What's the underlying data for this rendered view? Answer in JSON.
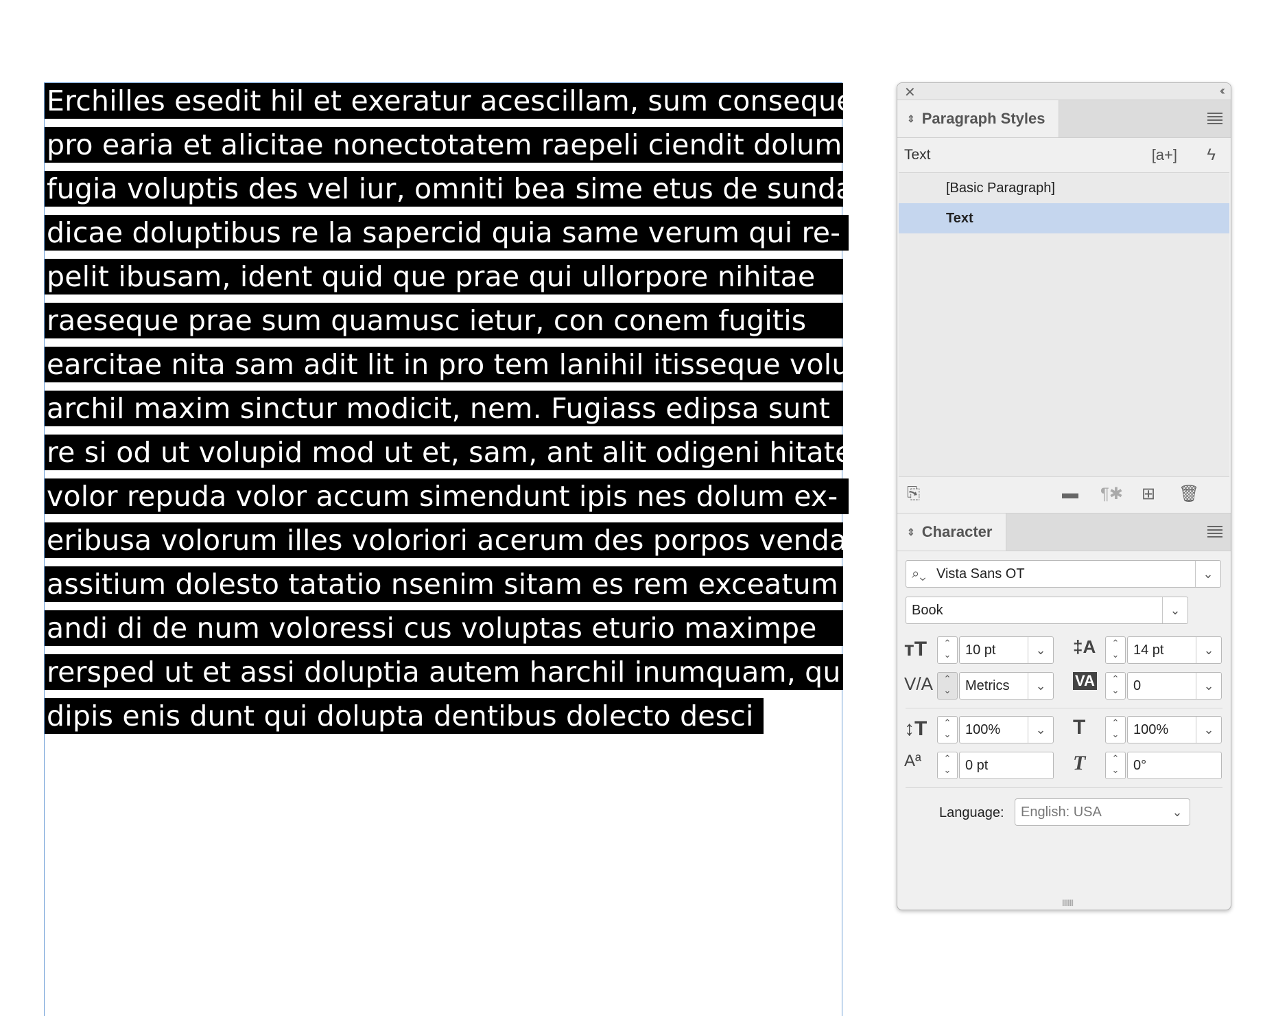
{
  "body_text": {
    "lines": [
      "Erchilles esedit hil et exeratur acescillam, sum conseque",
      "pro earia et alicitae nonectotatem raepeli ciendit dolum",
      "fugia voluptis des vel iur, omniti bea sime etus de sunda",
      "dicae doluptibus re la sapercid quia same verum qui re-",
      "pelit ibusam, ident quid que prae qui ullorpore nihitae",
      "raeseque prae sum quamusc ietur, con conem fugitis",
      "earcitae nita sam adit lit in pro tem lanihil itisseque volut",
      "archil maxim sinctur modicit, nem. Fugiass edipsa sunt",
      "re si od ut volupid mod ut et, sam, ant alit odigeni hitate",
      "volor repuda volor accum simendunt ipis nes dolum ex-",
      "eribusa volorum illes voloriori acerum des porpos vendam",
      "assitium dolesto tatatio nsenim sitam es rem exceatum",
      "andi di de num voloressi cus voluptas eturio maximpe",
      "rersped ut et assi doluptia autem harchil inumquam, quis",
      "dipis enis dunt qui dolupta dentibus dolecto desci"
    ]
  },
  "panel": {
    "close_glyph": "✕",
    "collapse_glyph": "‹‹",
    "paragraph_styles": {
      "tab_label": "Paragraph Styles",
      "current_style": "Text",
      "items": [
        "[Basic Paragraph]",
        "Text"
      ],
      "selected_index": 1
    },
    "character": {
      "tab_label": "Character",
      "font_family": "Vista Sans OT",
      "font_style": "Book",
      "font_size": "10 pt",
      "leading": "14 pt",
      "kerning": "Metrics",
      "tracking": "0",
      "vertical_scale": "100%",
      "horizontal_scale": "100%",
      "baseline_shift": "0 pt",
      "skew": "0°",
      "language_label": "Language:",
      "language": "English: USA"
    }
  },
  "colors": {
    "highlight": "#000000",
    "selected_row": "#c5d6ee",
    "frame_edge": "#6f9fd6"
  }
}
